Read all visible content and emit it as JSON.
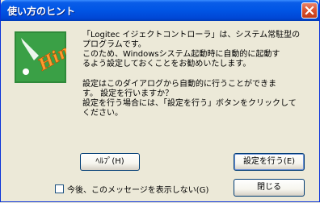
{
  "window": {
    "title": "使い方のヒント"
  },
  "logo": {
    "text": "Hint"
  },
  "message": {
    "lines1": [
      "「Logitec イジェクトコントローラ」は、システム常駐型の",
      "プログラムです。",
      "このため、Windowsシステム起動時に自動的に起動す",
      "るよう設定しておくことをお勧めいたします。"
    ],
    "lines2": [
      "設定はこのダイアログから自動的に行うことができま",
      "す。 設定を行いますか？",
      "設定を行う場合には、「設定を行う」ボタンをクリックして",
      "ください。"
    ]
  },
  "buttons": {
    "help": "ﾍﾙﾌﾟ(H)",
    "setup": "設定を行う(E)",
    "close": "閉じる"
  },
  "checkbox": {
    "label": "今後、このメッセージを表示しない(G)",
    "checked": false
  },
  "colors": {
    "titlebar": "#0055e5",
    "body": "#ece9d8",
    "close": "#d8512e"
  }
}
